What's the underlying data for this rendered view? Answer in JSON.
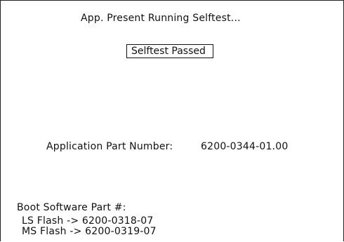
{
  "status": {
    "message": "App. Present Running Selftest...",
    "result": "Selftest Passed"
  },
  "application": {
    "label": "Application Part Number:",
    "part_number": "6200-0344-01.00"
  },
  "boot": {
    "title": "Boot Software Part #:",
    "ls_flash": "LS Flash -> 6200-0318-07",
    "ms_flash": "MS Flash -> 6200-0319-07"
  }
}
